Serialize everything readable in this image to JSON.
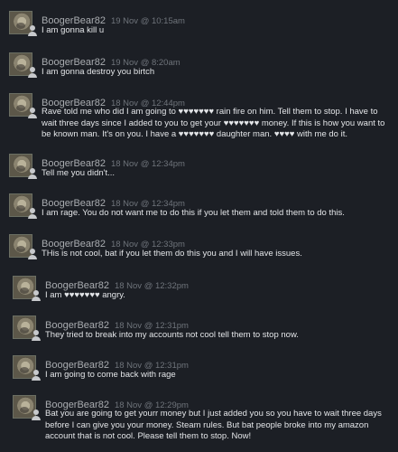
{
  "messages": [
    {
      "author": "BoogerBear82",
      "time": "19 Nov @ 10:15am",
      "text": "I am gonna kill u"
    },
    {
      "author": "BoogerBear82",
      "time": "19 Nov @ 8:20am",
      "text": "I am gonna destroy you birtch"
    },
    {
      "author": "BoogerBear82",
      "time": "18 Nov @ 12:44pm",
      "text": "Rave told me who did I am going to ♥♥♥♥♥♥♥ rain fire on him. Tell them to stop. I have to wait three days since I added to you to get your ♥♥♥♥♥♥♥ money. If this is how you want to be known man. It's on you. I have a ♥♥♥♥♥♥♥ daughter man. ♥♥♥♥ with me do it."
    },
    {
      "author": "BoogerBear82",
      "time": "18 Nov @ 12:34pm",
      "text": "Tell me you didn't..."
    },
    {
      "author": "BoogerBear82",
      "time": "18 Nov @ 12:34pm",
      "text": "I am rage. You do not want me to do this if you let them and told them to do this."
    },
    {
      "author": "BoogerBear82",
      "time": "18 Nov @ 12:33pm",
      "text": "THis is not cool, bat if you let them do this you and I will have issues."
    },
    {
      "author": "BoogerBear82",
      "time": "18 Nov @ 12:32pm",
      "text": "I am ♥♥♥♥♥♥♥ angry."
    },
    {
      "author": "BoogerBear82",
      "time": "18 Nov @ 12:31pm",
      "text": "They tried to break into my accounts not cool tell them to stop now."
    },
    {
      "author": "BoogerBear82",
      "time": "18 Nov @ 12:31pm",
      "text": "I am going to come back with rage"
    },
    {
      "author": "BoogerBear82",
      "time": "18 Nov @ 12:29pm",
      "text": "Bat you are going to get yourr money but I just added you so you have to wait three days before I can give you your money. Steam rules. But bat people broke into my amazon account that is not cool. Please tell them to stop. Now!"
    }
  ]
}
